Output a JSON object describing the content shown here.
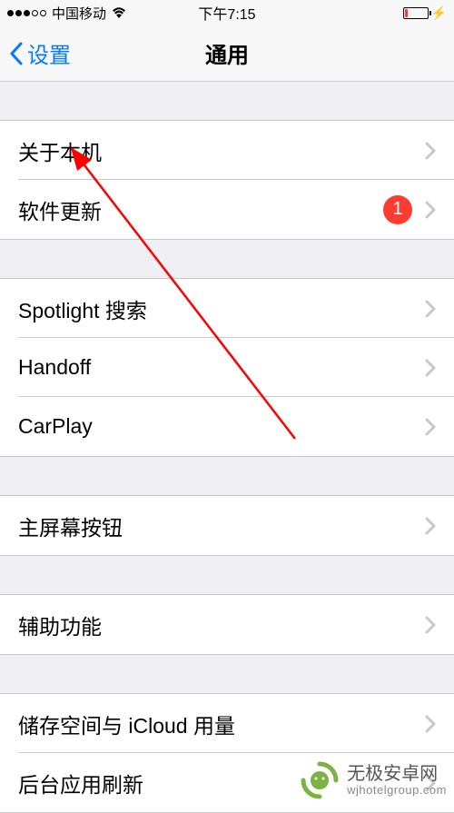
{
  "statusbar": {
    "carrier": "中国移动",
    "time": "下午7:15"
  },
  "nav": {
    "back_label": "设置",
    "title": "通用"
  },
  "groups": [
    {
      "items": [
        {
          "label": "关于本机",
          "badge": null
        },
        {
          "label": "软件更新",
          "badge": "1"
        }
      ]
    },
    {
      "items": [
        {
          "label": "Spotlight 搜索",
          "badge": null
        },
        {
          "label": "Handoff",
          "badge": null
        },
        {
          "label": "CarPlay",
          "badge": null
        }
      ]
    },
    {
      "items": [
        {
          "label": "主屏幕按钮",
          "badge": null
        }
      ]
    },
    {
      "items": [
        {
          "label": "辅助功能",
          "badge": null
        }
      ]
    },
    {
      "items": [
        {
          "label": "储存空间与 iCloud 用量",
          "badge": null
        },
        {
          "label": "后台应用刷新",
          "badge": null
        }
      ]
    }
  ],
  "watermark": {
    "title": "无极安卓网",
    "url": "wjhotelgroup.com"
  }
}
